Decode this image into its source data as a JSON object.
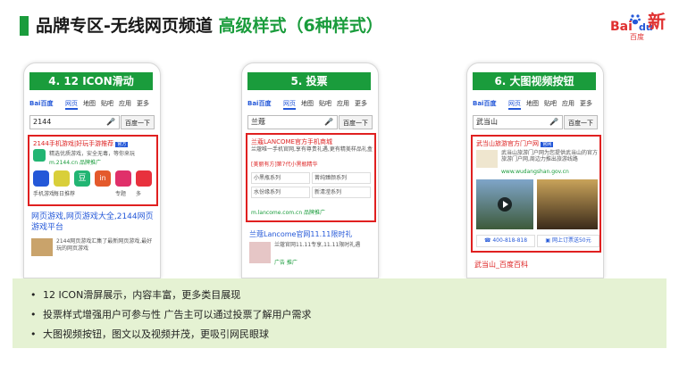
{
  "header": {
    "title_main": "品牌专区-无线网页频道",
    "title_accent": "高级样式（6种样式）"
  },
  "logo": {
    "bai": "Bai",
    "du": "du",
    "xin": "新",
    "sub": "百度"
  },
  "colors": {
    "green": "#1a9c3c",
    "red_box": "#e02020",
    "link_blue": "#2458d8",
    "bullet_bg": "#e5f2d3"
  },
  "phones": [
    {
      "title": "4. 12 ICON滑动",
      "tabs": [
        "Bai百度",
        "网页",
        "地图",
        "贴吧",
        "应用",
        "更多"
      ],
      "query": "2144",
      "search_button": "百度一下",
      "ad_title": "2144手机游戏|好玩手游推荐",
      "ad_badge": "官方",
      "ad_desc": "精选优质游戏，安全无毒，等你来玩",
      "ad_url": "m.2144.cn 品牌推广",
      "icon_labels": [
        "手机游戏",
        "每日推荐",
        "豆",
        "in",
        "专题",
        "多"
      ],
      "result_title": "网页游戏,网页游戏大全,2144网页游戏平台",
      "result_desc": "2144网页游戏汇集了最新网页游戏,最好玩的网页游戏"
    },
    {
      "title": "5. 投票",
      "tabs": [
        "Bai百度",
        "网页",
        "地图",
        "贴吧",
        "应用",
        "更多"
      ],
      "query": "兰蔻",
      "search_button": "百度一下",
      "ad_title": "兰蔻LANCOME官方手机商城",
      "ad_desc": "兰蔻唯一手机官网,享有尊贵礼遇,更有精美样品礼盒",
      "ad_line2": "[美丽有方]第7代小黑瓶精华",
      "vote_options": [
        "小黑瓶系列",
        "菁纯臻颜系列",
        "水份缘系列",
        "新清滢系列"
      ],
      "ad_url": "m.lancome.com.cn 品牌推广",
      "result_title": "兰蔻Lancome官网11.11限时礼",
      "result_desc": "兰蔻官网11.11专享,11.11限时礼遇",
      "result_url": "广告 推广"
    },
    {
      "title": "6. 大图视频按钮",
      "tabs": [
        "Bai百度",
        "网页",
        "地图",
        "贴吧",
        "应用",
        "更多"
      ],
      "query": "武当山",
      "search_button": "百度一下",
      "ad_title": "武当山旅游官方门户网",
      "ad_badge": "官网",
      "ad_desc": "武当山旅游门户网为您提供武当山的官方旅游门户网,周边力推出旅游线路",
      "ad_url": "www.wudangshan.gov.cn",
      "phone_number": "400-818-818",
      "online_label": "网上订票送50元",
      "result_title": "武当山_百度百科"
    }
  ],
  "bullets": [
    "12 ICON滑屏展示，内容丰富，更多类目展现",
    "投票样式增强用户可参与性 广告主可以通过投票了解用户需求",
    "大图视频按钮，图文以及视频并茂，更吸引网民眼球"
  ]
}
